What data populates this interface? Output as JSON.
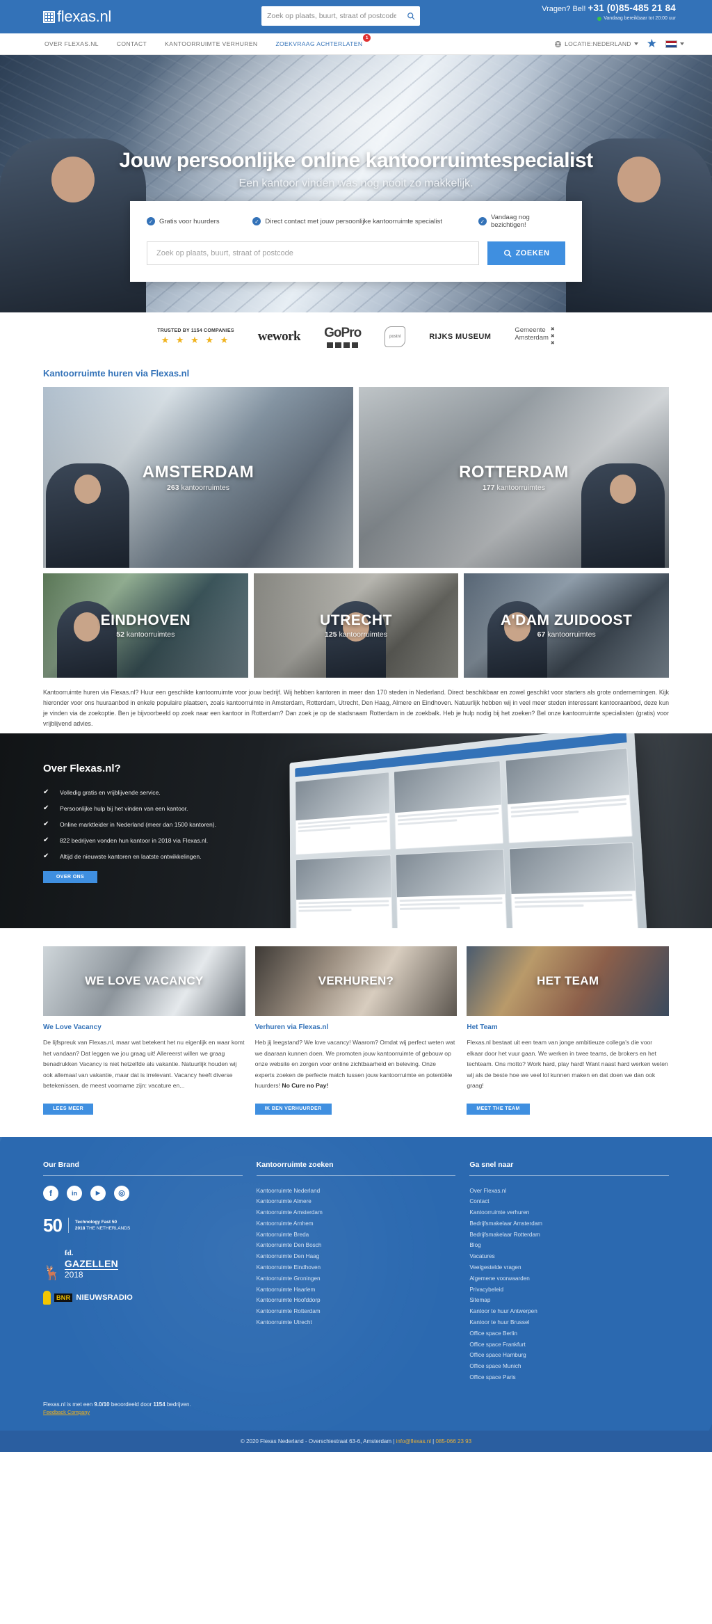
{
  "header": {
    "logo_text": "flexas.nl",
    "search_placeholder": "Zoek op plaats, buurt, straat of postcode",
    "search_value": "",
    "phone_prefix": "Vragen? Bel!",
    "phone_number": "+31 (0)85-485 21 84",
    "availability": "Vandaag bereikbaar tot 20:00 uur"
  },
  "nav": {
    "items": [
      {
        "label": "OVER FLEXAS.NL",
        "active": false,
        "badge": ""
      },
      {
        "label": "CONTACT",
        "active": false,
        "badge": ""
      },
      {
        "label": "KANTOORRUIMTE VERHUREN",
        "active": false,
        "badge": ""
      },
      {
        "label": "ZOEKVRAAG ACHTERLATEN",
        "active": true,
        "badge": "1"
      }
    ],
    "location_label": "LOCATIE:NEDERLAND"
  },
  "hero": {
    "title": "Jouw persoonlijke online kantoorruimtespecialist",
    "subtitle": "Een kantoor vinden was nog nooit zo makkelijk.",
    "bullets": [
      "Gratis voor huurders",
      "Direct contact met jouw persoonlijke kantoorruimte specialist",
      "Vandaag nog bezichtigen!"
    ],
    "search_placeholder": "Zoek op plaats, buurt, straat of postcode",
    "search_value": "",
    "search_button": "ZOEKEN"
  },
  "trusted": {
    "label": "TRUSTED BY 1154 COMPANIES",
    "stars": "★ ★ ★ ★ ★",
    "logos": [
      "wework",
      "GoPro",
      "postnl",
      "RIJKS MUSEUM",
      "Gemeente Amsterdam"
    ]
  },
  "cities": {
    "section_title": "Kantoorruimte huren via Flexas.nl",
    "items": [
      {
        "name": "AMSTERDAM",
        "count": "263",
        "suffix": " kantoorruimtes"
      },
      {
        "name": "ROTTERDAM",
        "count": "177",
        "suffix": " kantoorruimtes"
      },
      {
        "name": "EINDHOVEN",
        "count": "52",
        "suffix": " kantoorruimtes"
      },
      {
        "name": "UTRECHT",
        "count": "125",
        "suffix": " kantoorruimtes"
      },
      {
        "name": "A'DAM ZUIDOOST",
        "count": "67",
        "suffix": " kantoorruimtes"
      }
    ],
    "intro": "Kantoorruimte huren via Flexas.nl? Huur een geschikte kantoorruimte voor jouw bedrijf. Wij hebben kantoren in meer dan 170 steden in Nederland. Direct beschikbaar en zowel geschikt voor starters als grote ondernemingen. Kijk hieronder voor ons huuraanbod in enkele populaire plaatsen, zoals kantoorruimte in Amsterdam, Rotterdam, Utrecht, Den Haag, Almere en Eindhoven. Natuurlijk hebben wij in veel meer steden interessant kantooraanbod, deze kun je vinden via de zoekoptie. Ben je bijvoorbeeld op zoek naar een kantoor in Rotterdam? Dan zoek je op de stadsnaam Rotterdam in de zoekbalk. Heb je hulp nodig bij het zoeken? Bel onze kantoorruimte specialisten (gratis) voor vrijblijvend advies."
  },
  "about": {
    "heading_light": "Over ",
    "heading_bold": "Flexas.nl?",
    "items": [
      "Volledig gratis en vrijblijvende service.",
      "Persoonlijke hulp bij het vinden van een kantoor.",
      "Online marktleider in Nederland (meer dan 1500 kantoren).",
      "822 bedrijven vonden hun kantoor in 2018 via Flexas.nl.",
      "Altijd de nieuwste kantoren en laatste ontwikkelingen."
    ],
    "button": "OVER ONS"
  },
  "articles": [
    {
      "image_label": "WE LOVE VACANCY",
      "title": "We Love Vacancy",
      "body": "De lijfspreuk van Flexas.nl, maar wat betekent het nu eigenlijk en waar komt het vandaan? Dat leggen we jou graag uit! Allereerst willen we graag benadrukken Vacancy is niet hetzelfde als vakantie. Natuurlijk houden wij ook allemaal van vakantie, maar dat is irrelevant. Vacancy heeft diverse betekenissen, de meest voorname zijn: vacature en...",
      "body_bold": "",
      "button": "LEES MEER"
    },
    {
      "image_label": "VERHUREN?",
      "title": "Verhuren via Flexas.nl",
      "body": "Heb jij leegstand? We love vacancy! Waarom? Omdat wij perfect weten wat we daaraan kunnen doen. We promoten jouw kantoorruimte of gebouw op onze website en zorgen voor online zichtbaarheid en beleving. Onze experts zoeken de perfecte match tussen jouw kantoorruimte en potentiële huurders! ",
      "body_bold": "No Cure no Pay!",
      "button": "IK BEN VERHUURDER"
    },
    {
      "image_label": "HET TEAM",
      "title": "Het Team",
      "body": "Flexas.nl bestaat uit een team van jonge ambitieuze collega's die voor elkaar door het vuur gaan. We werken in twee teams, de brokers en het techteam. Ons motto? Work hard, play hard! Want naast hard werken weten wij als de beste hoe we veel lol kunnen maken en dat doen we dan ook graag!",
      "body_bold": "",
      "button": "MEET THE TEAM"
    }
  ],
  "footer": {
    "brand_col": {
      "title": "Our Brand",
      "socials": [
        "facebook-icon",
        "linkedin-icon",
        "youtube-icon",
        "instagram-icon"
      ],
      "award_fast50_number": "50",
      "award_fast50_line1": "Technology Fast 50",
      "award_fast50_line2_bold": "2018",
      "award_fast50_line2": "THE NETHERLANDS",
      "gazellen_fd": "fd.",
      "gazellen_name": "GAZELLEN",
      "gazellen_year": "2018",
      "bnr_tag": "BNR",
      "bnr_text": "NIEUWSRADIO"
    },
    "search_col": {
      "title": "Kantoorruimte zoeken",
      "links": [
        "Kantoorruimte Nederland",
        "Kantoorruimte Almere",
        "Kantoorruimte Amsterdam",
        "Kantoorruimte Arnhem",
        "Kantoorruimte Breda",
        "Kantoorruimte Den Bosch",
        "Kantoorruimte Den Haag",
        "Kantoorruimte Eindhoven",
        "Kantoorruimte Groningen",
        "Kantoorruimte Haarlem",
        "Kantoorruimte Hoofddorp",
        "Kantoorruimte Rotterdam",
        "Kantoorruimte Utrecht"
      ]
    },
    "quick_col": {
      "title": "Ga snel naar",
      "links": [
        "Over Flexas.nl",
        "Contact",
        "Kantoorruimte verhuren",
        "Bedrijfsmakelaar Amsterdam",
        "Bedrijfsmakelaar Rotterdam",
        "Blog",
        "Vacatures",
        "Veelgestelde vragen",
        "Algemene voorwaarden",
        "Privacybeleid",
        "Sitemap",
        "Kantoor te huur Antwerpen",
        "Kantoor te huur Brussel",
        "Office space Berlin",
        "Office space Frankfurt",
        "Office space Hamburg",
        "Office space Munich",
        "Office space Paris"
      ]
    },
    "rating_prefix": "Flexas.nl is met een ",
    "rating_score": "9.0/10",
    "rating_mid": " beoordeeld door ",
    "rating_count": "1154",
    "rating_suffix": " bedrijven.",
    "feedback_company": "Feedback Company",
    "copyright": "© 2020 Flexas Nederland - Overschiestraat 63-6, Amsterdam  |  ",
    "copyright_email": "info@flexas.nl",
    "copyright_sep": "  |  ",
    "copyright_phone": "085-066 23 93"
  },
  "colors": {
    "brand_blue": "#3372b8",
    "accent_blue": "#3f8fe0",
    "footer_blue": "#2b69b0",
    "star_yellow": "#f0b21c",
    "badge_red": "#e03030"
  }
}
